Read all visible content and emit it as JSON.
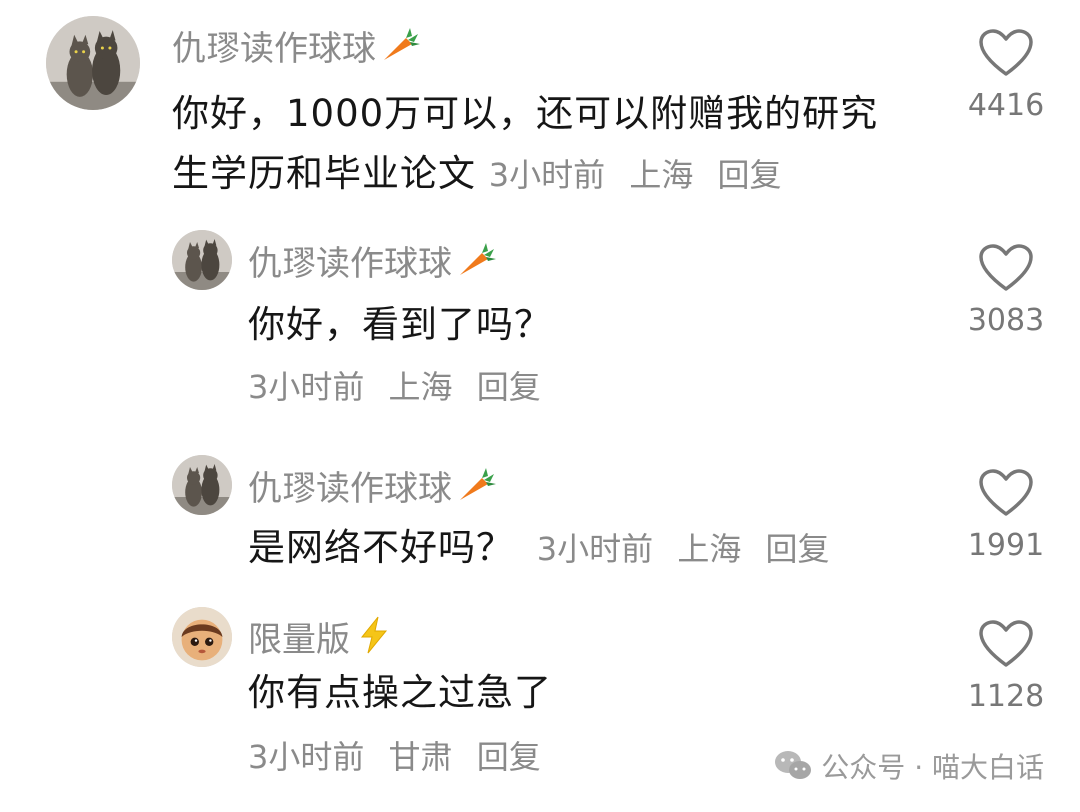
{
  "comments": [
    {
      "username": "仇璆读作球球",
      "badge_icon": "carrot-icon",
      "text": "你好，1000万可以，还可以附赠我的研究生学历和毕业论文",
      "time": "3小时前",
      "location": "上海",
      "reply_label": "回复",
      "likes": "4416"
    },
    {
      "username": "仇璆读作球球",
      "badge_icon": "carrot-icon",
      "text": "你好，看到了吗？",
      "time": "3小时前",
      "location": "上海",
      "reply_label": "回复",
      "likes": "3083"
    },
    {
      "username": "仇璆读作球球",
      "badge_icon": "carrot-icon",
      "text": "是网络不好吗？",
      "time": "3小时前",
      "location": "上海",
      "reply_label": "回复",
      "likes": "1991"
    },
    {
      "username": "限量版",
      "badge_icon": "lightning-icon",
      "text": "你有点操之过急了",
      "time": "3小时前",
      "location": "甘肃",
      "reply_label": "回复",
      "likes": "1128"
    }
  ],
  "watermark": {
    "icon": "wechat-icon",
    "text": "公众号 · 喵大白话"
  },
  "colors": {
    "secondary_text": "#8a8a8a",
    "primary_text": "#161616",
    "carrot": "#f07a1c",
    "lightning": "#f5c518"
  }
}
